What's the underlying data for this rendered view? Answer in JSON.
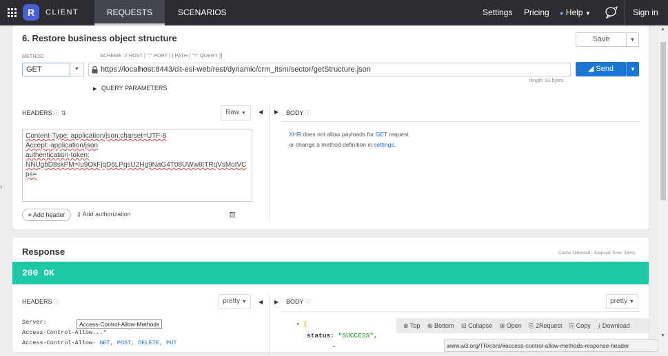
{
  "topbar": {
    "brand_letter": "R",
    "brand_name": "CLIENT",
    "tabs": [
      "REQUESTS",
      "SCENARIOS"
    ],
    "settings": "Settings",
    "pricing": "Pricing",
    "help": "Help",
    "signin": "Sign in"
  },
  "request": {
    "title": "6. Restore business object structure",
    "save_label": "Save",
    "method_label": "METHOD",
    "method_value": "GET",
    "url_hint": "SCHEME :// HOST [ \":\" PORT ] [ PATH [ \"?\" QUERY ]]",
    "url": "https://localhost:8443/cit-esi-web/rest/dynamic/crm_itsm/sector/getStructure.json",
    "send_label": "Send",
    "length_label": "length: 81 bytes",
    "query_params": "QUERY PARAMETERS",
    "headers_title": "HEADERS",
    "raw_label": "Raw",
    "body_title": "BODY",
    "headers_lines": [
      "Content-Type: application/json;charset=UTF-8",
      "Accept: application/json",
      "authentication-token:",
      "NNUgbD8skPM=Iu9OkFjqD6LPqsU2Hg9NaG4T08UWw8tTRqVsMotVC",
      "ps="
    ],
    "body_msg_xhr": "XHR",
    "body_msg_1": "does not allow payloads for",
    "body_msg_get": "GET",
    "body_msg_2": "request",
    "body_msg_3": "or change a method definition in",
    "body_msg_settings": "settings",
    "body_msg_dot": ".",
    "add_header": "Add header",
    "add_auth": "Add authorization"
  },
  "response": {
    "title": "Response",
    "meta": "Cache Detected - Elapsed Time: 36ms",
    "status": "200 OK",
    "status_color": "#1ec8a5",
    "headers_title": "HEADERS",
    "pretty_label": "pretty",
    "body_title": "BODY",
    "header_lines": [
      "Server:",
      "Access-Control-Allow...*",
      "Access-Control-Allow-"
    ],
    "methods_inline": "GET, POST, DELETE, PUT",
    "tooltip": "Access-Control-Allow-Methods",
    "toolbar": [
      "Top",
      "Bottom",
      "Collapse",
      "Open",
      "2Request",
      "Copy",
      "Download"
    ],
    "json_brace": "{",
    "json_key": "status:",
    "json_value": "\"SUCCESS\"",
    "json_comma": ",",
    "status_url": "www.w3.org/TR/cors/#access-control-allow-methods-response-header"
  }
}
